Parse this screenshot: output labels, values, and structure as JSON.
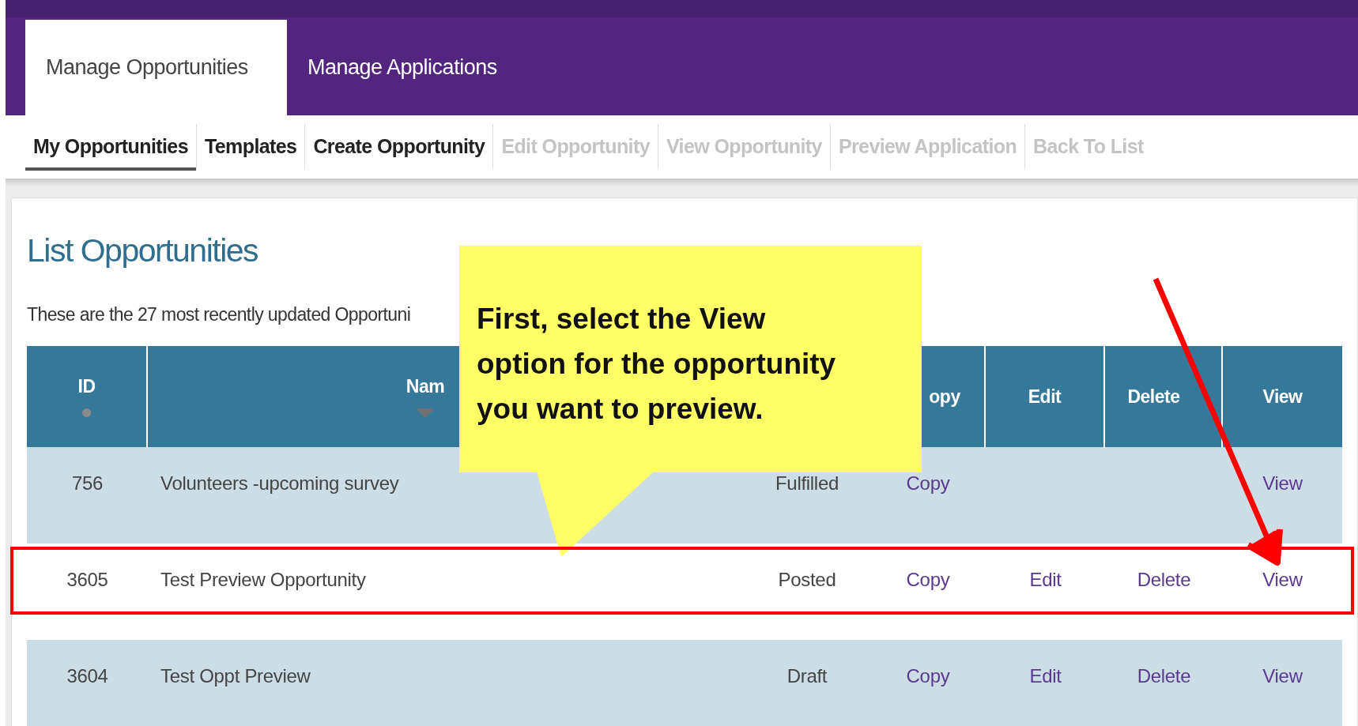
{
  "nav": {
    "tabs": [
      {
        "label": "Manage Opportunities",
        "selected": true
      },
      {
        "label": "Manage Applications",
        "selected": false
      }
    ]
  },
  "subnav": [
    {
      "label": "My Opportunities",
      "selected": true,
      "disabled": false
    },
    {
      "label": "Templates",
      "selected": false,
      "disabled": false
    },
    {
      "label": "Create Opportunity",
      "selected": false,
      "disabled": false
    },
    {
      "label": "Edit Opportunity",
      "selected": false,
      "disabled": true
    },
    {
      "label": "View Opportunity",
      "selected": false,
      "disabled": true
    },
    {
      "label": "Preview Application",
      "selected": false,
      "disabled": true
    },
    {
      "label": "Back To List",
      "selected": false,
      "disabled": true
    }
  ],
  "page": {
    "title": "List Opportunities",
    "description": "These are the 27 most recently updated Opportuni"
  },
  "table": {
    "columns": [
      {
        "label": "ID",
        "sorted": false
      },
      {
        "label": "Nam",
        "sorted": true
      },
      {},
      {
        "label": "opy"
      },
      {
        "label": "Edit"
      },
      {
        "label": "Delete"
      },
      {
        "label": "View"
      }
    ],
    "rows": [
      {
        "id": "756",
        "name": "Volunteers -upcoming survey",
        "status": "Fulfilled",
        "copy": "Copy",
        "view": "View",
        "highlighted": false
      },
      {
        "id": "3605",
        "name": "Test Preview Opportunity",
        "status": "Posted",
        "copy": "Copy",
        "edit": "Edit",
        "delete": "Delete",
        "view": "View",
        "highlighted": true
      },
      {
        "id": "3604",
        "name": "Test Oppt Preview",
        "status": "Draft",
        "copy": "Copy",
        "edit": "Edit",
        "delete": "Delete",
        "view": "View",
        "highlighted": false
      }
    ]
  },
  "callout": {
    "text": "First, select the View\noption for the opportunity\nyou want to preview."
  }
}
